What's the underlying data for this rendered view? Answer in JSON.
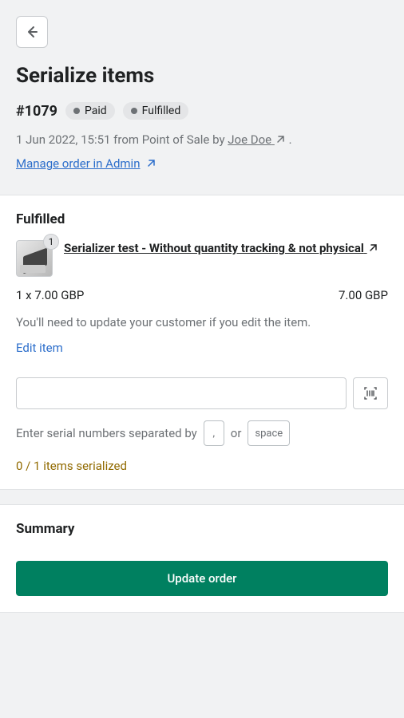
{
  "page": {
    "title": "Serialize items"
  },
  "order": {
    "id": "#1079",
    "badges": {
      "paid": "Paid",
      "fulfilled": "Fulfilled"
    },
    "meta_prefix": "1 Jun 2022, 15:51 from Point of Sale by ",
    "author": "Joe Doe",
    "meta_suffix": " .",
    "admin_link": "Manage order in Admin"
  },
  "fulfilled": {
    "title": "Fulfilled",
    "item": {
      "qty_badge": "1",
      "name": "Serializer test - Without quantity tracking & not physical",
      "qty_price": "1 x 7.00 GBP",
      "line_total": "7.00 GBP"
    },
    "note": "You'll need to update your customer if you edit the item.",
    "edit": "Edit item",
    "hint_prefix": "Enter serial numbers separated by",
    "hint_or": "or",
    "key_comma": ",",
    "key_space": "space",
    "progress": "0 / 1 items serialized"
  },
  "summary": {
    "title": "Summary",
    "button": "Update order"
  }
}
